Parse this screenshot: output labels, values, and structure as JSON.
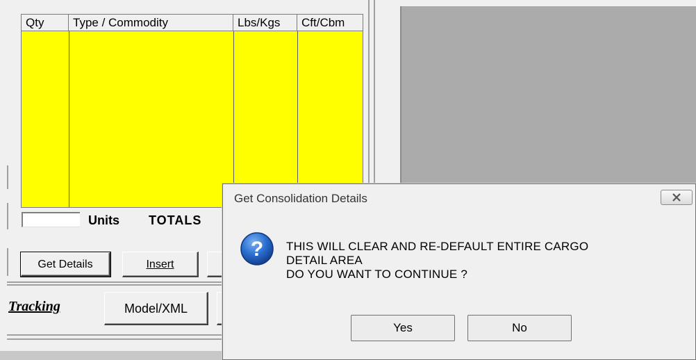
{
  "grid": {
    "columns": [
      "Qty",
      "Type / Commodity",
      "Lbs/Kgs",
      "Cft/Cbm"
    ]
  },
  "totals_row": {
    "units_value": "",
    "units_label": "Units",
    "totals_label": "TOTALS"
  },
  "action_buttons": {
    "get_details": "Get Details",
    "insert": "Insert"
  },
  "bottom_tabs": {
    "tracking": "Tracking",
    "model_xml": "Model/XML"
  },
  "dialog": {
    "title": "Get Consolidation Details",
    "message_line1": "THIS WILL CLEAR AND RE-DEFAULT ENTIRE CARGO",
    "message_line2": "DETAIL AREA",
    "message_line3": "DO YOU WANT TO CONTINUE ?",
    "yes_label": "Yes",
    "no_label": "No",
    "icon": "question-icon"
  },
  "colors": {
    "grid_background": "#ffff00",
    "right_pane": "#ababab",
    "icon_blue": "#1f5fbf"
  }
}
